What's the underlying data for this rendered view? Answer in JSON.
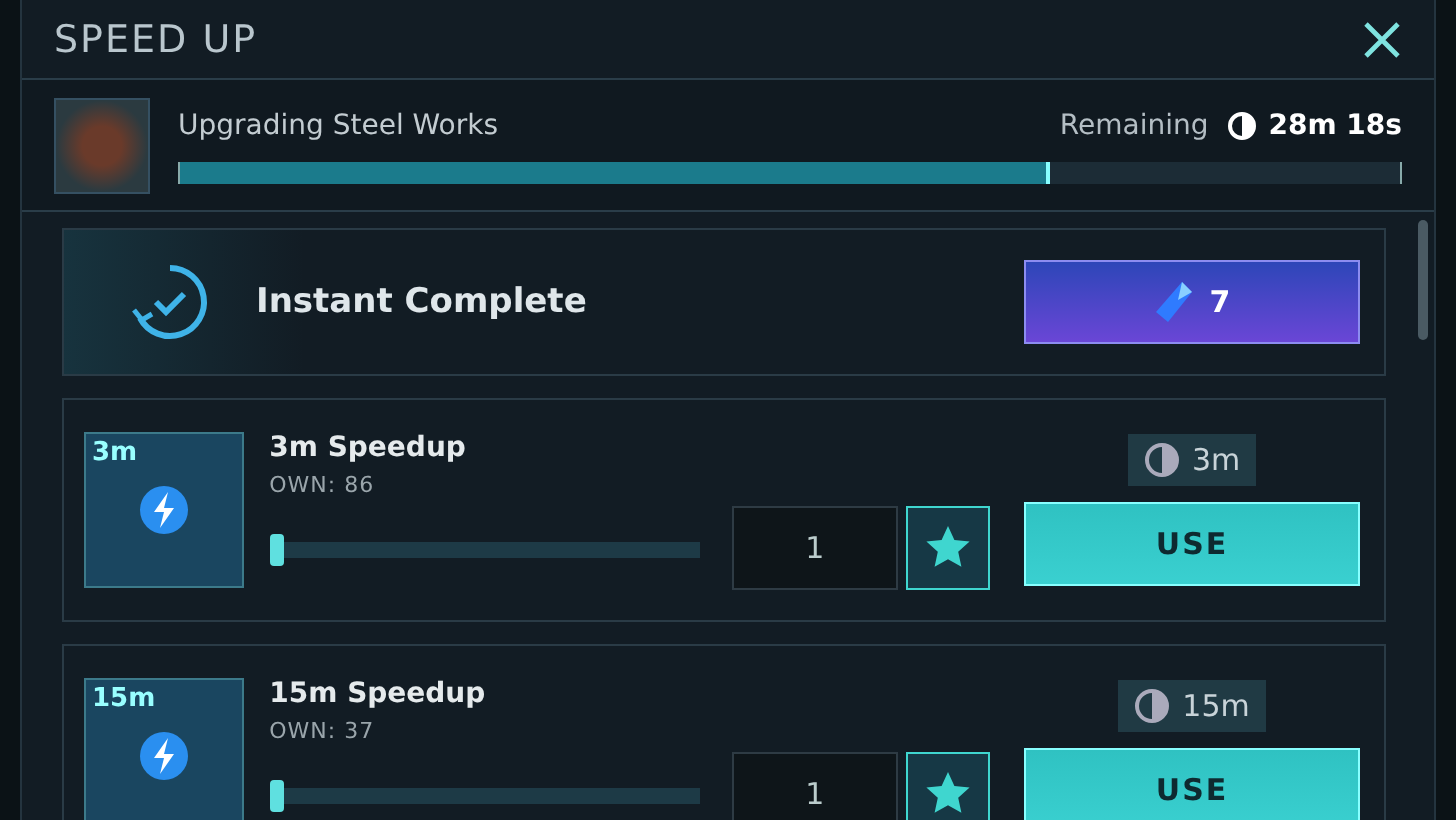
{
  "window": {
    "title": "SPEED UP"
  },
  "task": {
    "label": "Upgrading Steel Works",
    "remaining_label": "Remaining",
    "remaining_time": "28m 18s",
    "level": 0.71
  },
  "instant": {
    "label": "Instant Complete",
    "cost": "7"
  },
  "items": [
    {
      "badge": "3m",
      "name": "3m Speedup",
      "own": "OWN: 86",
      "level": 0,
      "quantity": "1",
      "time": "3m",
      "button": "USE"
    },
    {
      "badge": "15m",
      "name": "15m Speedup",
      "own": "OWN: 37",
      "level": 0,
      "quantity": "1",
      "time": "15m",
      "button": "USE"
    }
  ]
}
